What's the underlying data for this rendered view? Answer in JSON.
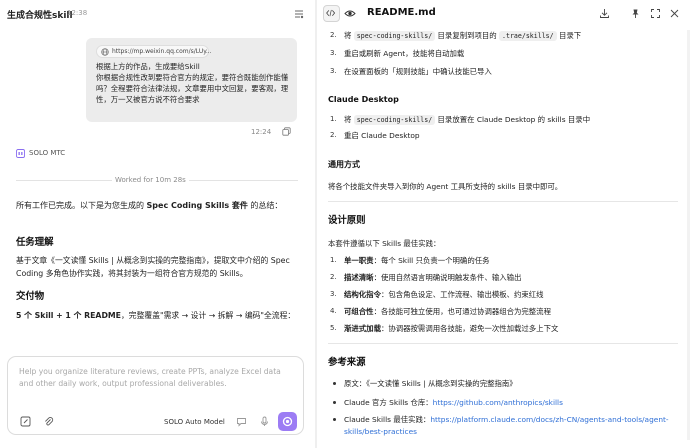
{
  "chat": {
    "title": "生成合规性skill",
    "time": "12:38",
    "message": {
      "link": "https://mp.weixin.qq.com/s/LUy...",
      "text": "根据上方的作品，生成要给Skill\n你根据合规性改到要符合官方的规定，要符合既能创作能懂吗？全程要符合法律法规，文章要用中文回复，要客观，理性，万一又被官方说不符合要求",
      "time": "12:24"
    },
    "agent": "SOLO MTC",
    "worked": "Worked for 10m 28s",
    "summary_prefix": "所有工作已完成。以下是为您生成的 ",
    "summary_bold": "Spec Coding Skills 套件",
    "summary_suffix": " 的总结：",
    "task_heading": "任务理解",
    "task_text": "基于文章《一文读懂 Skills | 从概念到实操的完整指南》，提取文中介绍的 Spec Coding 多角色协作实践，将其封装为一组符合官方规范的 Skills。",
    "deliv_heading": "交付物",
    "deliv_bold": "5 个 Skill + 1 个 README",
    "deliv_rest": "，完整覆盖\"需求 → 设计 → 拆解 → 编码\"全流程：",
    "composer_placeholder": "Help you organize literature reviews, create PPTs, analyze Excel data and other daily work, output professional deliverables.",
    "model": "SOLO Auto Model"
  },
  "readme": {
    "title": "README.md",
    "trae_steps": [
      {
        "n": "2.",
        "pre": "将 ",
        "code1": "spec-coding-skills/",
        "mid": " 目录复制到项目的 ",
        "code2": ".trae/skills/",
        "post": " 目录下"
      },
      {
        "n": "3.",
        "text": "重启或刷新 Agent，技能将自动加载"
      },
      {
        "n": "3.",
        "text": "在设置面板的「规则技能」中确认技能已导入"
      }
    ],
    "claude_desktop": {
      "heading": "Claude Desktop",
      "steps": [
        {
          "n": "1.",
          "pre": "将 ",
          "code1": "spec-coding-skills/",
          "post": " 目录放置在 Claude Desktop 的 skills 目录中"
        },
        {
          "n": "2.",
          "text": "重启 Claude Desktop"
        }
      ]
    },
    "general": {
      "heading": "通用方式",
      "text": "将各个技能文件夹导入到你的 Agent 工具所支持的 skills 目录中即可。"
    },
    "design": {
      "heading": "设计原则",
      "intro": "本套件遵循以下 Skills 最佳实践：",
      "items": [
        {
          "n": "1.",
          "bold": "单一职责",
          "text": "：每个 Skill 只负责一个明确的任务"
        },
        {
          "n": "2.",
          "bold": "描述清晰",
          "text": "：使用自然语言明确说明触发条件、输入输出"
        },
        {
          "n": "3.",
          "bold": "结构化指令",
          "text": "：包含角色设定、工作流程、输出模板、约束红线"
        },
        {
          "n": "4.",
          "bold": "可组合性",
          "text": "：各技能可独立使用，也可通过协调器组合为完整流程"
        },
        {
          "n": "5.",
          "bold": "渐进式加载",
          "text": "：协调器按需调用各技能，避免一次性加载过多上下文"
        }
      ]
    },
    "refs": {
      "heading": "参考来源",
      "items": [
        {
          "label": "原文：",
          "text": "《一文读懂 Skills | 从概念到实操的完整指南》"
        },
        {
          "label": "Claude 官方 Skills 仓库：",
          "link": "https://github.com/anthropics/skills"
        },
        {
          "label": "Claude Skills 最佳实践：",
          "link": "https://platform.claude.com/docs/zh-CN/agents-and-tools/agent-",
          "link2": "skills/best-practices"
        }
      ]
    }
  },
  "colors": {
    "accent": "#9c7cf4",
    "link": "#2f6fd6"
  },
  "icons": [
    "menu-icon",
    "globe-icon",
    "copy-icon",
    "solo-icon",
    "expand-icon",
    "attach-icon",
    "chat-icon",
    "mic-icon",
    "send-icon",
    "code-icon",
    "eye-icon",
    "download-icon",
    "pin-icon",
    "fullscreen-icon",
    "close-icon"
  ]
}
